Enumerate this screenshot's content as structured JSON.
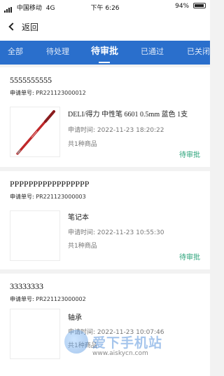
{
  "status_bar": {
    "carrier": "中国移动",
    "network": "4G",
    "time": "下午 6:26",
    "battery": "94%"
  },
  "nav": {
    "back_label": "返回"
  },
  "tabs": [
    {
      "label": "全部"
    },
    {
      "label": "待处理"
    },
    {
      "label": "待审批"
    },
    {
      "label": "已通过"
    },
    {
      "label": "已关闭"
    }
  ],
  "orders": [
    {
      "title": "5555555555",
      "order_label": "申请单号:",
      "order_no": "PR221123000012",
      "item_name": "DELI/得力 中性笔 6601 0.5mm 蓝色 1支",
      "time_label": "申请时间:",
      "time": "2022-11-23 18:20:22",
      "count": "共1种商品",
      "status": "待审批"
    },
    {
      "title": "PPPPPPPPPPPPPPPPP",
      "order_label": "申请单号:",
      "order_no": "PR221123000003",
      "item_name": "笔记本",
      "time_label": "申请时间:",
      "time": "2022-11-23 10:55:30",
      "count": "共1种商品",
      "status": "待审批"
    },
    {
      "title": "33333333",
      "order_label": "申请单号:",
      "order_no": "PR221123000002",
      "item_name": "轴承",
      "time_label": "申请时间:",
      "time": "2022-11-23 10:07:46",
      "count": "共1种商品",
      "status": ""
    }
  ],
  "watermark": {
    "brand": "爱下手机站",
    "url": "www.aiskycn.com"
  },
  "colors": {
    "tab_bar": "#2a6fcc",
    "status_green": "#2aa37a",
    "pen_red": "#c0282a"
  }
}
